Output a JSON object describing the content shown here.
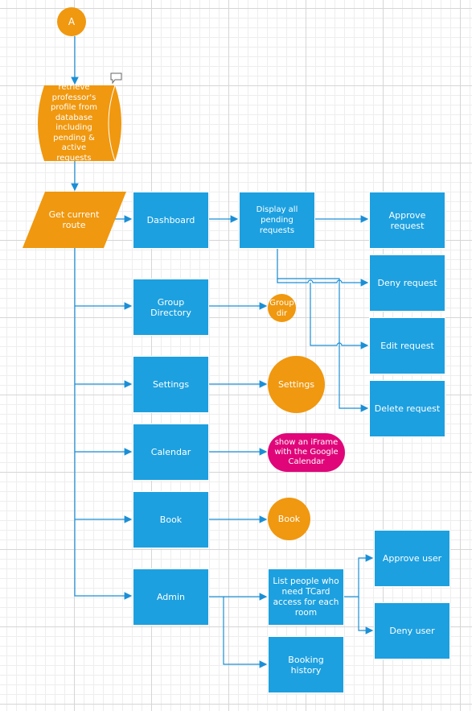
{
  "colors": {
    "process": "#1ca0e0",
    "terminal": "#f0980f",
    "highlight": "#e0067a",
    "connector": "#1a8fd6"
  },
  "start": {
    "label": "A"
  },
  "database": {
    "label": "retrieve professor's profile from database including pending & active requests",
    "comment_icon": "speech-bubble-icon"
  },
  "route": {
    "label": "Get current route"
  },
  "menu": {
    "dashboard": "Dashboard",
    "group_directory": "Group Directory",
    "settings": "Settings",
    "calendar": "Calendar",
    "book": "Book",
    "admin": "Admin"
  },
  "dashboard": {
    "display": "Display all pending requests",
    "approve": "Approve request",
    "deny": "Deny request",
    "edit": "Edit request",
    "delete": "Delete request"
  },
  "ends": {
    "group_dir": "Group dir",
    "settings": "Settings",
    "calendar": "show an iFrame with the Google Calendar",
    "book": "Book"
  },
  "admin": {
    "list": "List people who need TCard access for each room",
    "booking_history": "Booking history",
    "approve_user": "Approve user",
    "deny_user": "Deny user"
  }
}
